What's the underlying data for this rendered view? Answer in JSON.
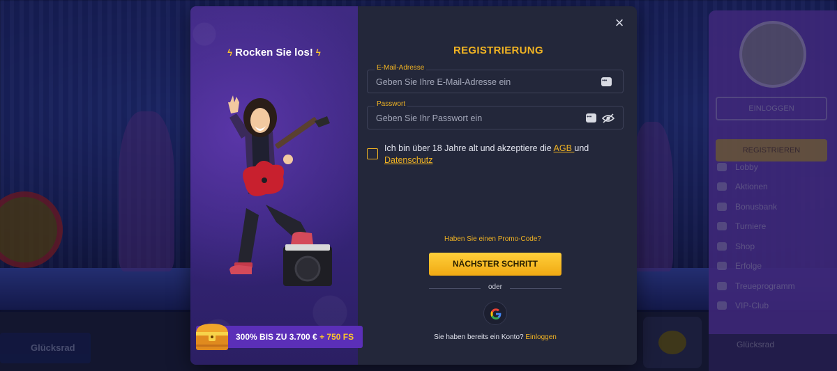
{
  "background": {
    "footer_chip_label": "Glücksrad",
    "sidebar": {
      "login_label": "EINLOGGEN",
      "register_label": "REGISTRIEREN",
      "items": [
        "Lobby",
        "Aktionen",
        "Bonusbank",
        "Turniere",
        "Shop",
        "Erfolge",
        "Treueprogramm",
        "VIP-Club"
      ],
      "wheel_label": "Glücksrad"
    }
  },
  "modal": {
    "promo_panel": {
      "title": "Rocken Sie los!",
      "bonus_text": "300% BIS ZU 3.700 €",
      "bonus_fs": "+ 750 FS"
    },
    "close_icon": "×",
    "title": "REGISTRIERUNG",
    "email": {
      "label": "E-Mail-Adresse",
      "placeholder": "Geben Sie Ihre E-Mail-Adresse ein",
      "value": ""
    },
    "password": {
      "label": "Passwort",
      "placeholder": "Geben Sie Ihr Passwort ein",
      "value": ""
    },
    "terms": {
      "checked": false,
      "text_before": "Ich bin über 18 Jahre alt und akzeptiere die ",
      "agb_link": "AGB ",
      "text_middle": "und",
      "privacy_link": "Datenschutz"
    },
    "promo_code_link": "Haben Sie einen Promo-Code?",
    "next_button": "NÄCHSTER SCHRITT",
    "divider_text": "oder",
    "google_icon": "google-icon",
    "login_prompt": "Sie haben bereits ein Konto?",
    "login_link": "Einloggen"
  },
  "colors": {
    "accent": "#f0b323",
    "modal_bg": "#23273a",
    "promo_panel": "#3f2a82",
    "bonus_bar": "#5b2fb8"
  }
}
